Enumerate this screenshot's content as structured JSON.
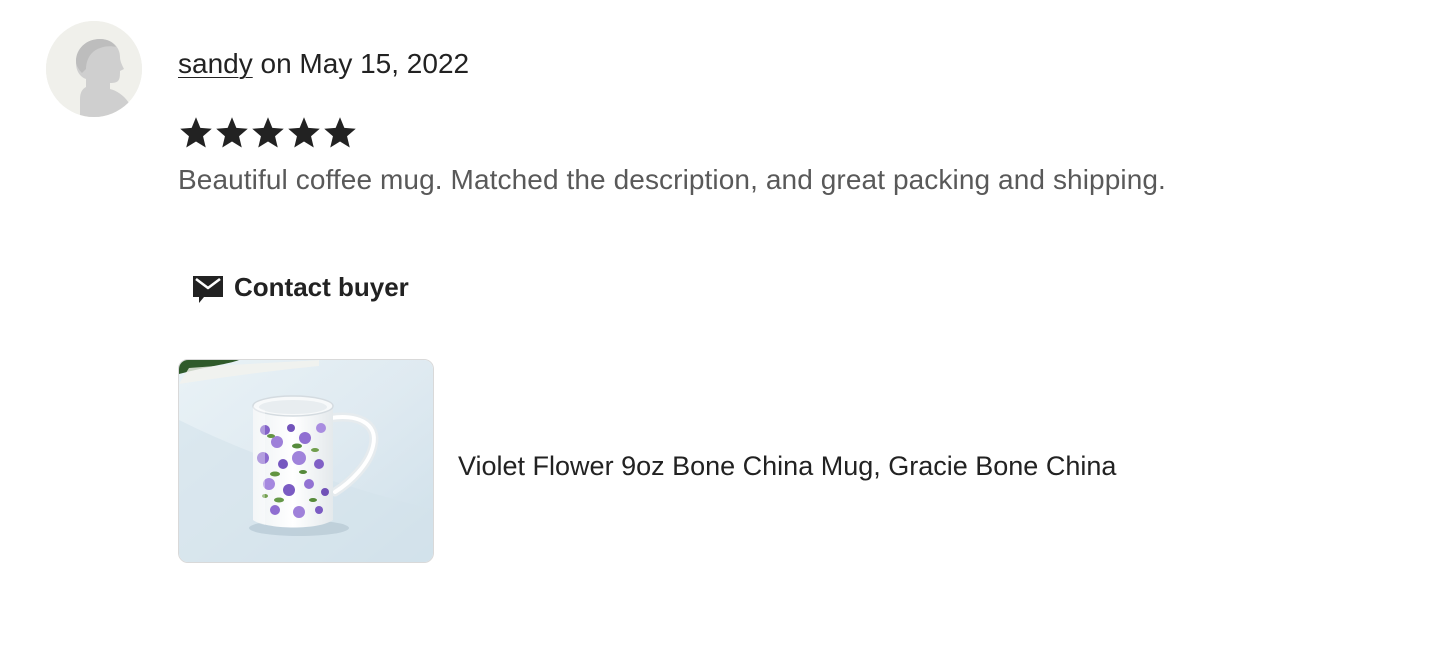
{
  "review": {
    "reviewer_name": "sandy",
    "date_text": " on May 15, 2022",
    "rating": 5,
    "rating_max": 5,
    "text": "Beautiful coffee mug. Matched the description, and great packing and shipping."
  },
  "actions": {
    "contact_label": "Contact buyer"
  },
  "listing": {
    "title": "Violet Flower 9oz Bone China Mug, Gracie Bone China"
  },
  "icons": {
    "avatar": "default-avatar-icon",
    "star": "star-icon",
    "contact": "envelope-message-icon"
  },
  "colors": {
    "text_primary": "#222222",
    "text_secondary": "#595959",
    "avatar_bg": "#f0f0eb",
    "avatar_figure": "#cfcfcf"
  }
}
